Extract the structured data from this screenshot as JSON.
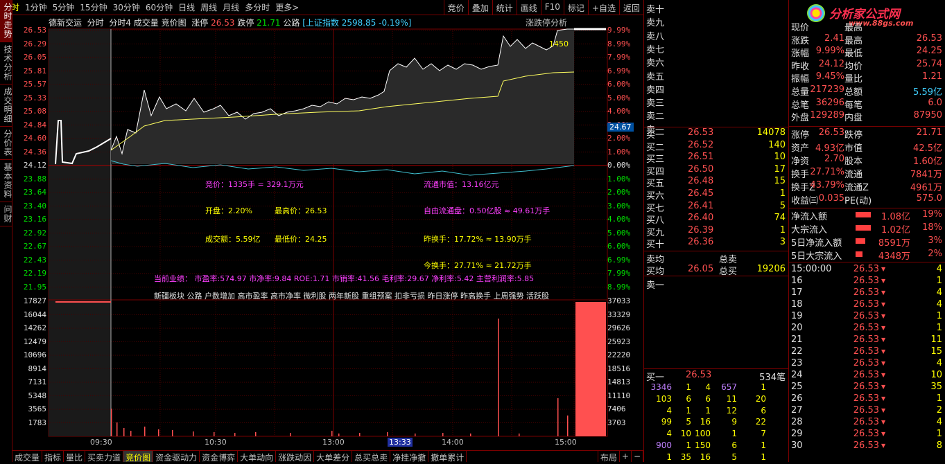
{
  "toolbar": {
    "periods": [
      "分时",
      "1分钟",
      "5分钟",
      "15分钟",
      "30分钟",
      "60分钟",
      "日线",
      "周线",
      "月线",
      "多分时",
      "更多>"
    ],
    "active": "分时",
    "right_buttons": [
      "竞价",
      "叠加",
      "统计",
      "画线",
      "F10",
      "标记",
      "+自选",
      "返回"
    ]
  },
  "left_tabs": [
    "分时走势",
    "技术分析",
    "成交明细",
    "分价表",
    "基本资料",
    "问财"
  ],
  "header": {
    "name": "德新交运",
    "mode1": "分时",
    "mode2": "分时4",
    "vol": "成交量",
    "bid": "竞价图",
    "zt_label": "涨停",
    "zt": "26.53",
    "dt_label": "跌停",
    "dt": "21.71",
    "sector": "公路",
    "index": "[上证指数",
    "index_val": "2598.85 -0.19%]",
    "analysis": "涨跌停分析"
  },
  "price_axis": {
    "left": [
      "26.53",
      "26.29",
      "26.05",
      "25.81",
      "25.57",
      "25.33",
      "25.08",
      "24.84",
      "24.60",
      "24.36",
      "24.12",
      "23.88",
      "23.64",
      "23.40",
      "23.16",
      "22.92",
      "22.67",
      "22.43",
      "22.19",
      "21.95"
    ],
    "right": [
      "9.99%",
      "8.99%",
      "7.99%",
      "6.99%",
      "6.00%",
      "5.00%",
      "4.00%",
      "3.00%",
      "2.00%",
      "1.00%",
      "0.00%",
      "1.00%",
      "2.00%",
      "3.00%",
      "4.00%",
      "5.00%",
      "6.00%",
      "6.99%",
      "7.99%",
      "8.99%"
    ],
    "cursor": "24.67",
    "tag": "1450"
  },
  "vol_axis": {
    "left": [
      "17827",
      "16044",
      "14262",
      "12479",
      "10696",
      "8914",
      "7131",
      "5348",
      "3565",
      "1783"
    ],
    "right": [
      "37033",
      "33329",
      "29626",
      "25923",
      "22220",
      "18516",
      "14813",
      "11110",
      "7406",
      "3703"
    ]
  },
  "time_axis": [
    "09:30",
    "10:30",
    "11:30",
    "13:00",
    "13:33",
    "14:00",
    "15:00"
  ],
  "info": {
    "bid_vol": "竞价：1335手 = 329.1万元",
    "float_mv": "流通市值：13.16亿元",
    "open": "开盘：2.20%",
    "high": "最高价：26.53",
    "free_float": "自由流通盘：0.50亿股 ≈ 49.61万手",
    "amount": "成交额：5.59亿",
    "low": "最低价：24.25",
    "yturn": "昨换手：17.72% ≈ 13.90万手",
    "tturn": "今换手：27.71% ≈ 21.72万手",
    "perf": "当前业绩：   市盈率:574.97  市净率:9.84   ROE:1.71   市销率:41.56  毛利率:29.67  净利率:5.42  主营利润率:5.85",
    "tags": "新疆板块 公路 户数增加 高市盈率 高市净率 微利股 两年新股 重组预案 扣非亏损 昨日涨停 昨高换手 上周强势 活跃股"
  },
  "bottom_tabs": [
    "成交量",
    "指标",
    "量比",
    "买卖力道",
    "竞价图",
    "资金驱动力",
    "资金博弈",
    "大单动向",
    "涨跌动因",
    "大单差分",
    "总买总卖",
    "净挂净撤",
    "撤单累计"
  ],
  "bottom_active": "竞价图",
  "bottom_right": "布局",
  "sell_labels": [
    "卖十",
    "卖九",
    "卖八",
    "卖七",
    "卖六",
    "卖五",
    "卖四",
    "卖三",
    "卖二",
    "卖一"
  ],
  "buy": [
    [
      "买一",
      "26.53",
      "14078"
    ],
    [
      "买二",
      "26.52",
      "140"
    ],
    [
      "买三",
      "26.51",
      "10"
    ],
    [
      "买四",
      "26.50",
      "17"
    ],
    [
      "买五",
      "26.48",
      "15"
    ],
    [
      "买六",
      "26.45",
      "1"
    ],
    [
      "买七",
      "26.41",
      "5"
    ],
    [
      "买八",
      "26.40",
      "74"
    ],
    [
      "买九",
      "26.39",
      "1"
    ],
    [
      "买十",
      "26.36",
      "3"
    ]
  ],
  "avg": {
    "sell_avg": "卖均",
    "total_sell": "总卖",
    "buy_avg": "买均",
    "buy_avg_val": "26.05",
    "total_buy": "总买",
    "total_buy_val": "19206",
    "sell1": "卖一"
  },
  "queue": {
    "label": "买一",
    "price": "26.53",
    "count": "534笔",
    "rows": [
      [
        "3346",
        "1",
        "4",
        "657",
        "1"
      ],
      [
        "103",
        "6",
        "6",
        "11",
        "20"
      ],
      [
        "4",
        "1",
        "1",
        "12",
        "6"
      ],
      [
        "99",
        "5",
        "16",
        "9",
        "22"
      ],
      [
        "4",
        "10",
        "100",
        "1",
        "7"
      ],
      [
        "900",
        "1",
        "150",
        "6",
        "1"
      ],
      [
        "1",
        "35",
        "16",
        "5",
        "1"
      ]
    ]
  },
  "quote": {
    "logo": "分析家公式网",
    "url": "www.88gs.com",
    "rows": [
      [
        "现价",
        "",
        "最高",
        ""
      ],
      [
        "涨跌",
        "2.41",
        "最高",
        "26.53"
      ],
      [
        "涨幅",
        "9.99%",
        "最低",
        "24.25"
      ],
      [
        "昨收",
        "24.12",
        "均价",
        "25.74"
      ],
      [
        "振幅",
        "9.45%",
        "量比",
        "1.21"
      ],
      [
        "总量",
        "217239",
        "总额",
        "5.59亿"
      ],
      [
        "总笔",
        "36296",
        "每笔",
        "6.0"
      ],
      [
        "外盘",
        "129289",
        "内盘",
        "87950"
      ]
    ],
    "rows2": [
      [
        "涨停",
        "26.53",
        "跌停",
        "21.71"
      ],
      [
        "资产",
        "4.93亿",
        "市值",
        "42.5亿"
      ],
      [
        "净资",
        "2.70",
        "股本",
        "1.60亿"
      ],
      [
        "换手",
        "27.71%",
        "流通",
        "7841万"
      ],
      [
        "换手Z",
        "43.79%",
        "流通Z",
        "4961万"
      ],
      [
        "收益㈢",
        "0.035",
        "PE(动)",
        "575.0"
      ]
    ],
    "flows": [
      [
        "净流入额",
        "1.08亿",
        "19%"
      ],
      [
        "大宗流入",
        "1.02亿",
        "18%"
      ],
      [
        "5日净流入额",
        "8591万",
        "3%"
      ],
      [
        "5日大宗流入",
        "4348万",
        "2%"
      ]
    ],
    "ticks_head": [
      "15:00:00",
      "26.53",
      "4"
    ],
    "ticks": [
      [
        "16",
        "26.53",
        "1"
      ],
      [
        "17",
        "26.53",
        "4"
      ],
      [
        "18",
        "26.53",
        "4"
      ],
      [
        "19",
        "26.53",
        "1"
      ],
      [
        "20",
        "26.53",
        "1"
      ],
      [
        "21",
        "26.53",
        "11"
      ],
      [
        "22",
        "26.53",
        "15"
      ],
      [
        "23",
        "26.53",
        "4"
      ],
      [
        "24",
        "26.53",
        "10"
      ],
      [
        "25",
        "26.53",
        "35"
      ],
      [
        "26",
        "26.53",
        "1"
      ],
      [
        "27",
        "26.53",
        "2"
      ],
      [
        "28",
        "26.53",
        "4"
      ],
      [
        "29",
        "26.53",
        "1"
      ],
      [
        "30",
        "26.53",
        "8"
      ]
    ]
  },
  "colors": {
    "up": "#ff5050",
    "down": "#00e000",
    "price_line": "#ffffff",
    "avg_line": "#ffff60",
    "bid_line": "#40c0d0",
    "grid": "#7a0000"
  }
}
